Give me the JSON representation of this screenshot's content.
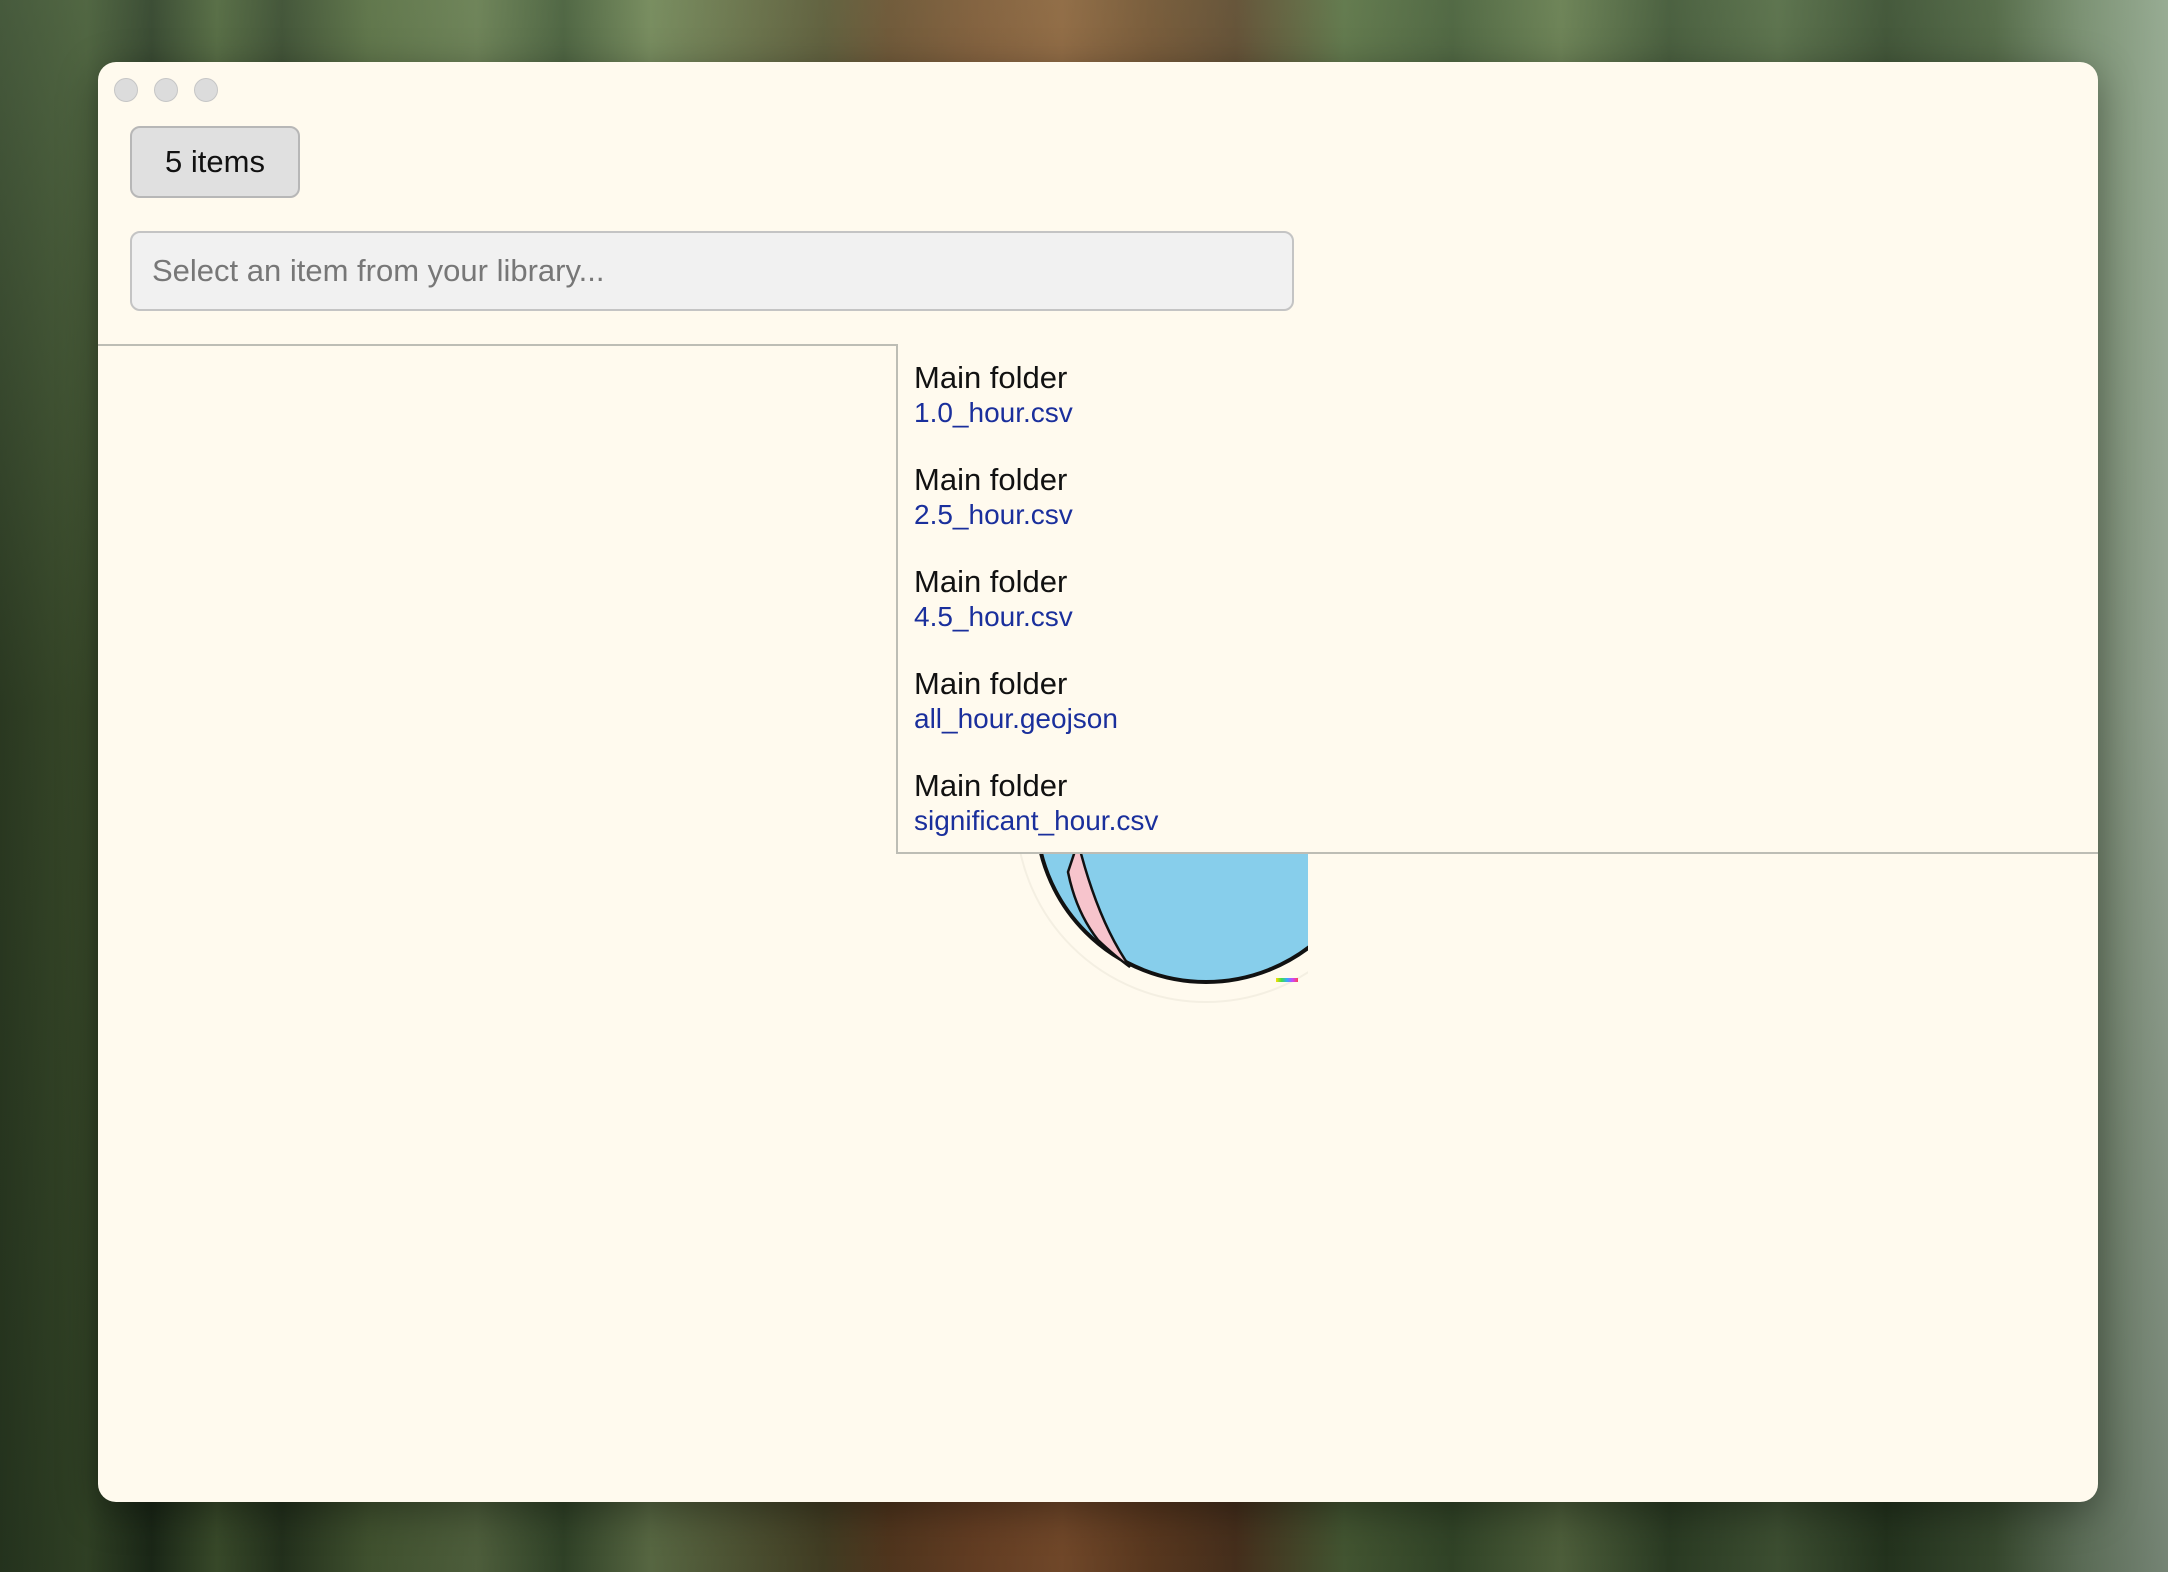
{
  "window": {
    "count_button_label": "5 items",
    "search": {
      "value": "",
      "placeholder": "Select an item from your library..."
    }
  },
  "results": [
    {
      "folder": "Main folder",
      "file": "1.0_hour.csv"
    },
    {
      "folder": "Main folder",
      "file": "2.5_hour.csv"
    },
    {
      "folder": "Main folder",
      "file": "4.5_hour.csv"
    },
    {
      "folder": "Main folder",
      "file": "all_hour.geojson"
    },
    {
      "folder": "Main folder",
      "file": "significant_hour.csv"
    }
  ],
  "colors": {
    "window_bg": "#fffaee",
    "link": "#1a2f9c",
    "globe_ocean": "#87ceeb",
    "globe_land": "#f7c4cc"
  }
}
